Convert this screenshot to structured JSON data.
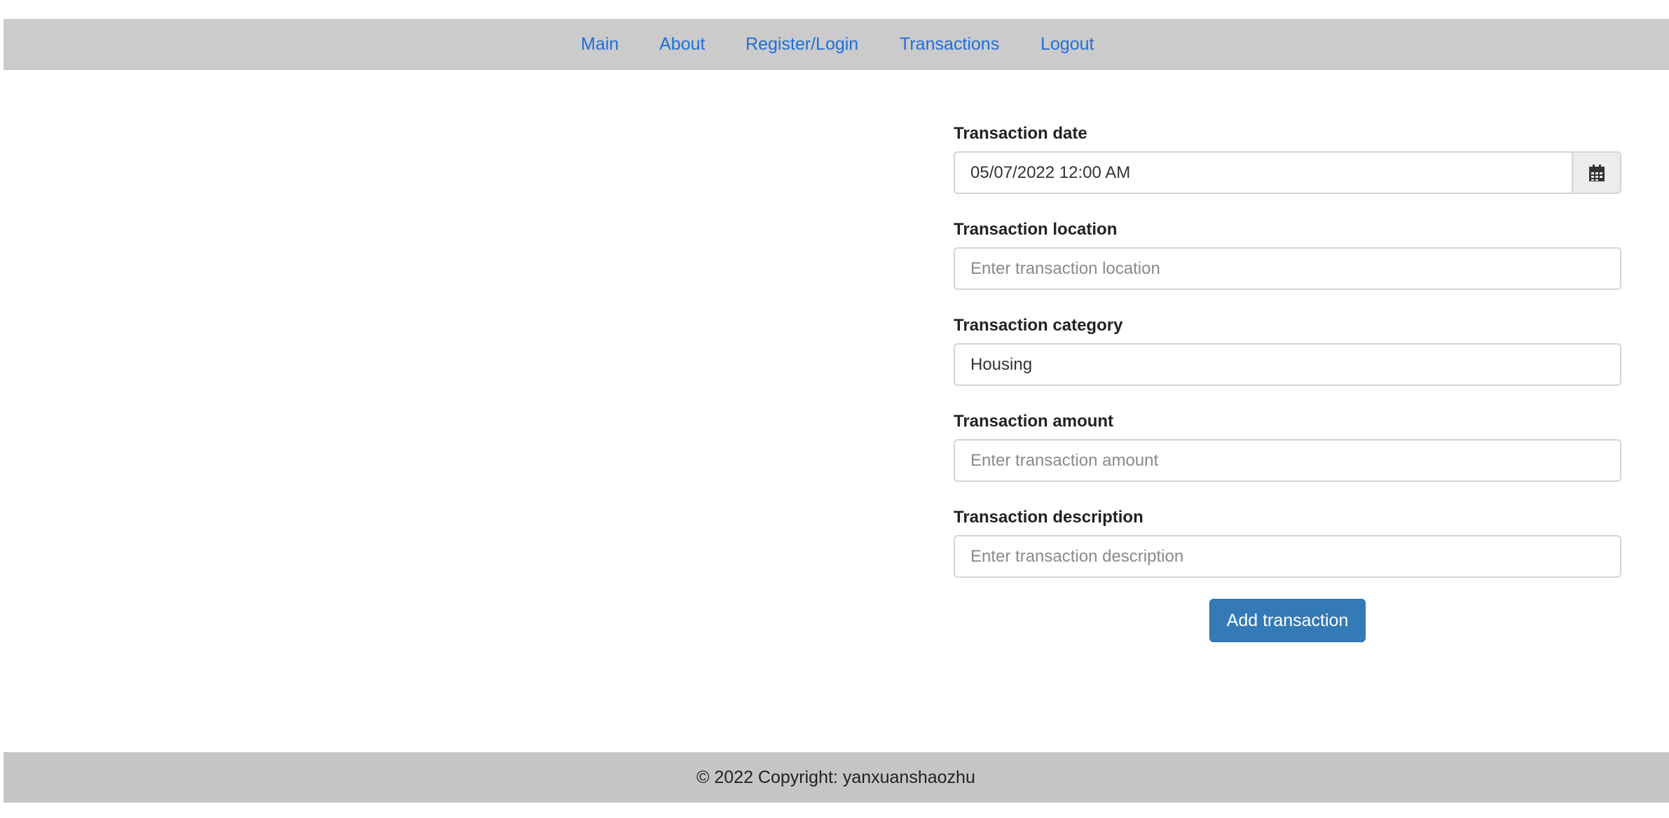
{
  "nav": {
    "items": [
      {
        "label": "Main"
      },
      {
        "label": "About"
      },
      {
        "label": "Register/Login"
      },
      {
        "label": "Transactions"
      },
      {
        "label": "Logout"
      }
    ]
  },
  "form": {
    "date": {
      "label": "Transaction date",
      "value": "05/07/2022 12:00 AM",
      "icon": "calendar-icon"
    },
    "location": {
      "label": "Transaction location",
      "value": "",
      "placeholder": "Enter transaction location"
    },
    "category": {
      "label": "Transaction category",
      "value": "Housing"
    },
    "amount": {
      "label": "Transaction amount",
      "value": "",
      "placeholder": "Enter transaction amount"
    },
    "description": {
      "label": "Transaction description",
      "value": "",
      "placeholder": "Enter transaction description"
    },
    "submit_label": "Add transaction"
  },
  "footer": {
    "text": "© 2022 Copyright: yanxuanshaozhu"
  },
  "colors": {
    "link": "#1e6fdb",
    "nav_bg": "#cbcbcb",
    "footer_bg": "#c4c5c6",
    "button": "#337ab7"
  }
}
